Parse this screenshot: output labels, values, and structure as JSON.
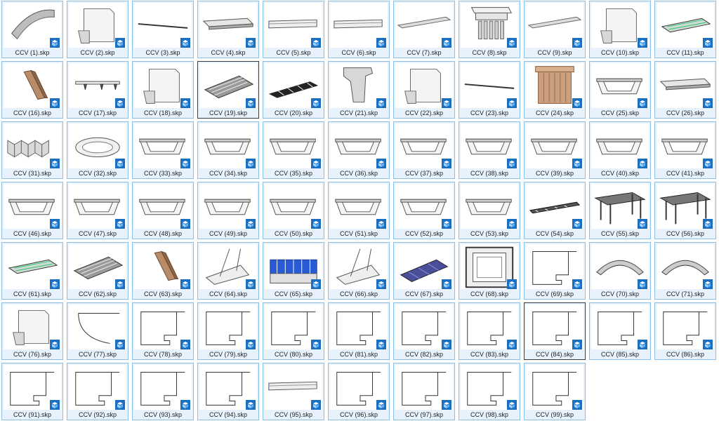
{
  "icons": {
    "file_type": "sketchup-file-icon",
    "badge_color": "#1a6fc1"
  },
  "selected": [
    "CCV (19).skp",
    "CCV (84).skp"
  ],
  "files": [
    {
      "name": "CCV (1).skp",
      "preview": "curved-canopy"
    },
    {
      "name": "CCV (2).skp",
      "preview": "cornice-block"
    },
    {
      "name": "CCV (3).skp",
      "preview": "thin-rod"
    },
    {
      "name": "CCV (4).skp",
      "preview": "flat-canopy"
    },
    {
      "name": "CCV (5).skp",
      "preview": "long-profile"
    },
    {
      "name": "CCV (6).skp",
      "preview": "long-profile"
    },
    {
      "name": "CCV (7).skp",
      "preview": "flat-strip"
    },
    {
      "name": "CCV (8).skp",
      "preview": "dentil-cornice"
    },
    {
      "name": "CCV (9).skp",
      "preview": "flat-strip"
    },
    {
      "name": "CCV (10).skp",
      "preview": "cornice-block"
    },
    {
      "name": "CCV (11).skp",
      "preview": "framed-panel"
    },
    {
      "name": "CCV (16).skp",
      "preview": "wood-beam"
    },
    {
      "name": "CCV (17).skp",
      "preview": "bracket-shelf"
    },
    {
      "name": "CCV (18).skp",
      "preview": "cornice-block"
    },
    {
      "name": "CCV (19).skp",
      "preview": "slatted-panel"
    },
    {
      "name": "CCV (20).skp",
      "preview": "dark-grate"
    },
    {
      "name": "CCV (21).skp",
      "preview": "corbel"
    },
    {
      "name": "CCV (22).skp",
      "preview": "cornice-block"
    },
    {
      "name": "CCV (23).skp",
      "preview": "thin-rod"
    },
    {
      "name": "CCV (24).skp",
      "preview": "wood-column"
    },
    {
      "name": "CCV (25).skp",
      "preview": "ceiling-frame"
    },
    {
      "name": "CCV (26).skp",
      "preview": "flat-canopy"
    },
    {
      "name": "CCV (31).skp",
      "preview": "fluted-panel"
    },
    {
      "name": "CCV (32).skp",
      "preview": "dome"
    },
    {
      "name": "CCV (33).skp",
      "preview": "ceiling-frame"
    },
    {
      "name": "CCV (34).skp",
      "preview": "ceiling-frame"
    },
    {
      "name": "CCV (35).skp",
      "preview": "ceiling-frame"
    },
    {
      "name": "CCV (36).skp",
      "preview": "ceiling-frame"
    },
    {
      "name": "CCV (37).skp",
      "preview": "ceiling-frame"
    },
    {
      "name": "CCV (38).skp",
      "preview": "ceiling-frame"
    },
    {
      "name": "CCV (39).skp",
      "preview": "ceiling-frame"
    },
    {
      "name": "CCV (40).skp",
      "preview": "ceiling-frame"
    },
    {
      "name": "CCV (41).skp",
      "preview": "ceiling-frame"
    },
    {
      "name": "CCV (46).skp",
      "preview": "ceiling-frame"
    },
    {
      "name": "CCV (47).skp",
      "preview": "ceiling-frame"
    },
    {
      "name": "CCV (48).skp",
      "preview": "ceiling-frame"
    },
    {
      "name": "CCV (49).skp",
      "preview": "ceiling-frame"
    },
    {
      "name": "CCV (50).skp",
      "preview": "ceiling-frame"
    },
    {
      "name": "CCV (51).skp",
      "preview": "ceiling-frame"
    },
    {
      "name": "CCV (52).skp",
      "preview": "ceiling-frame"
    },
    {
      "name": "CCV (53).skp",
      "preview": "ceiling-frame"
    },
    {
      "name": "CCV (54).skp",
      "preview": "truss"
    },
    {
      "name": "CCV (55).skp",
      "preview": "pergola"
    },
    {
      "name": "CCV (56).skp",
      "preview": "pergola"
    },
    {
      "name": "CCV (61).skp",
      "preview": "framed-panel"
    },
    {
      "name": "CCV (62).skp",
      "preview": "slatted-panel"
    },
    {
      "name": "CCV (63).skp",
      "preview": "wood-beam"
    },
    {
      "name": "CCV (64).skp",
      "preview": "cable-canopy"
    },
    {
      "name": "CCV (65).skp",
      "preview": "blue-shop"
    },
    {
      "name": "CCV (66).skp",
      "preview": "cable-canopy"
    },
    {
      "name": "CCV (67).skp",
      "preview": "solar-panel"
    },
    {
      "name": "CCV (68).skp",
      "preview": "square-frame"
    },
    {
      "name": "CCV (69).skp",
      "preview": "profile"
    },
    {
      "name": "CCV (70).skp",
      "preview": "arch"
    },
    {
      "name": "CCV (71).skp",
      "preview": "arch"
    },
    {
      "name": "CCV (76).skp",
      "preview": "cornice-block"
    },
    {
      "name": "CCV (77).skp",
      "preview": "curve-line"
    },
    {
      "name": "CCV (78).skp",
      "preview": "profile"
    },
    {
      "name": "CCV (79).skp",
      "preview": "profile"
    },
    {
      "name": "CCV (80).skp",
      "preview": "profile"
    },
    {
      "name": "CCV (81).skp",
      "preview": "profile"
    },
    {
      "name": "CCV (82).skp",
      "preview": "profile"
    },
    {
      "name": "CCV (83).skp",
      "preview": "profile"
    },
    {
      "name": "CCV (84).skp",
      "preview": "profile"
    },
    {
      "name": "CCV (85).skp",
      "preview": "profile"
    },
    {
      "name": "CCV (86).skp",
      "preview": "profile"
    },
    {
      "name": "CCV (91).skp",
      "preview": "profile"
    },
    {
      "name": "CCV (92).skp",
      "preview": "profile"
    },
    {
      "name": "CCV (93).skp",
      "preview": "profile"
    },
    {
      "name": "CCV (94).skp",
      "preview": "profile"
    },
    {
      "name": "CCV (95).skp",
      "preview": "long-profile"
    },
    {
      "name": "CCV (96).skp",
      "preview": "profile"
    },
    {
      "name": "CCV (97).skp",
      "preview": "profile"
    },
    {
      "name": "CCV (98).skp",
      "preview": "profile"
    },
    {
      "name": "CCV (99).skp",
      "preview": "profile"
    }
  ]
}
